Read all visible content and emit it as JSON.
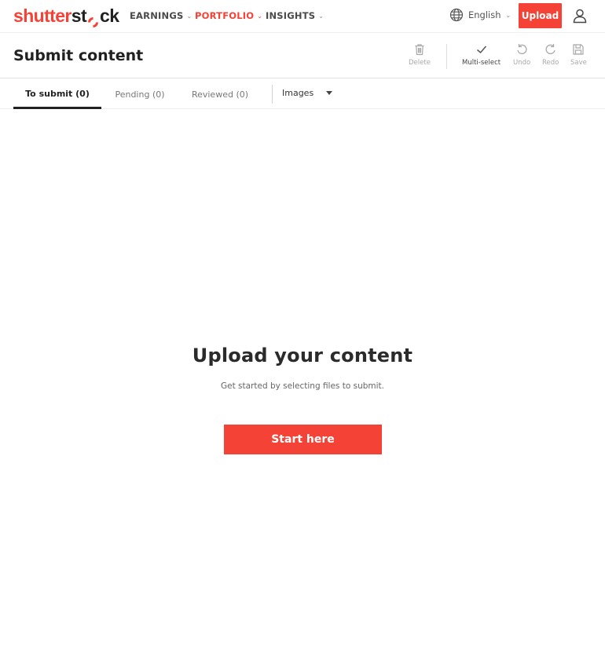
{
  "brand": {
    "logo_part1": "shutter",
    "logo_part2": "st",
    "logo_part3": "ck",
    "accent_color": "#f44336"
  },
  "nav": {
    "items": [
      {
        "label": "EARNINGS",
        "active": false
      },
      {
        "label": "PORTFOLIO",
        "active": true
      },
      {
        "label": "INSIGHTS",
        "active": false
      }
    ],
    "language": "English",
    "upload_label": "Upload",
    "icons": {
      "language": "globe-icon",
      "user": "user-icon",
      "dropdown": "chevron-down-icon"
    }
  },
  "titlebar": {
    "title": "Submit content",
    "tools": [
      {
        "label": "Delete",
        "icon": "trash-icon",
        "enabled": false
      },
      {
        "label": "Multi-select",
        "icon": "check-icon",
        "enabled": true
      },
      {
        "label": "Undo",
        "icon": "undo-icon",
        "enabled": false
      },
      {
        "label": "Redo",
        "icon": "redo-icon",
        "enabled": false
      },
      {
        "label": "Save",
        "icon": "save-icon",
        "enabled": false
      }
    ]
  },
  "tabs": {
    "items": [
      {
        "label": "To submit (0)",
        "active": true
      },
      {
        "label": "Pending (0)",
        "active": false
      },
      {
        "label": "Reviewed (0)",
        "active": false
      }
    ],
    "filter_value": "Images"
  },
  "empty_state": {
    "title": "Upload your content",
    "subtitle": "Get started by selecting files to submit.",
    "cta_label": "Start here"
  }
}
